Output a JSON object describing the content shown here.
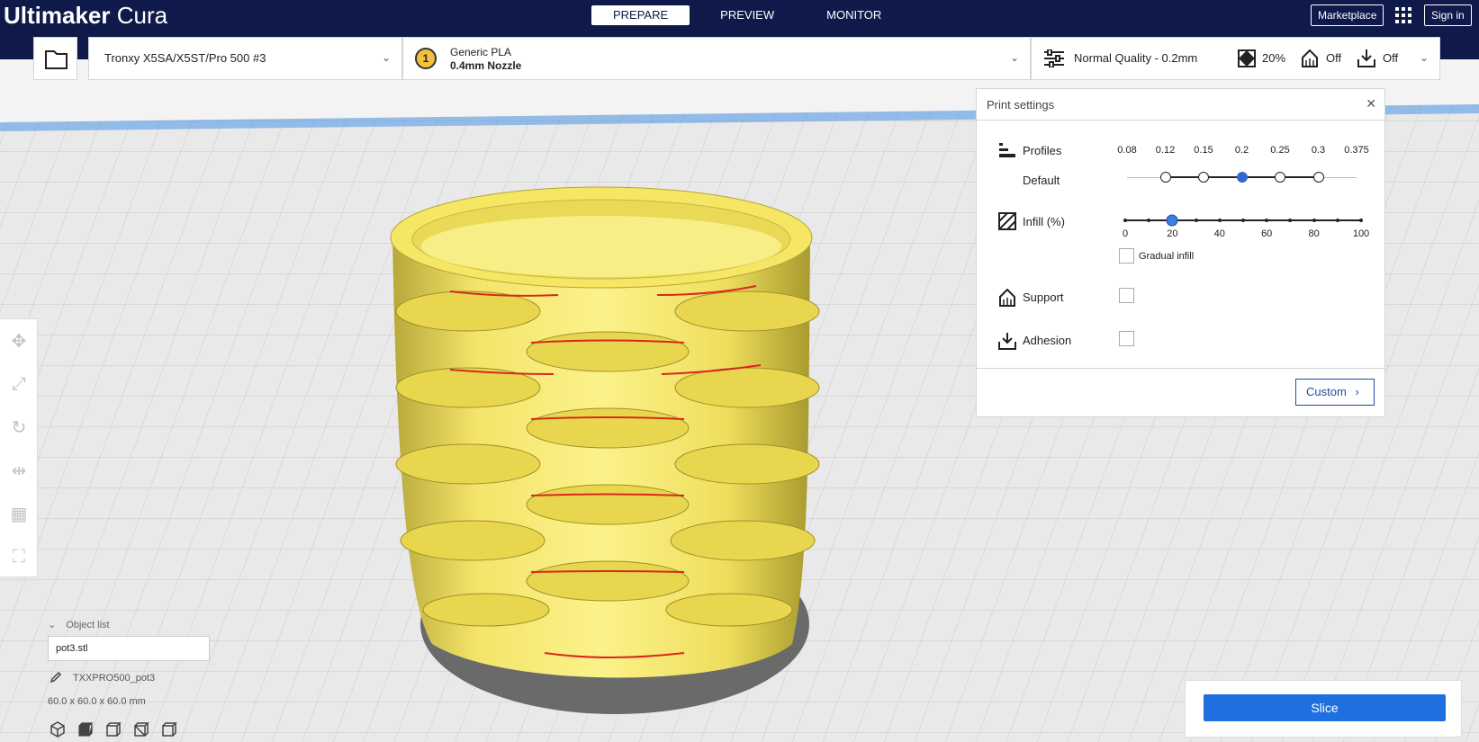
{
  "app": {
    "title_bold": "Ultimaker",
    "title_light": "Cura"
  },
  "stages": [
    {
      "label": "PREPARE",
      "active": true
    },
    {
      "label": "PREVIEW",
      "active": false
    },
    {
      "label": "MONITOR",
      "active": false
    }
  ],
  "header": {
    "marketplace": "Marketplace",
    "signin": "Sign in"
  },
  "printer": {
    "name": "Tronxy X5SA/X5ST/Pro 500 #3"
  },
  "material": {
    "extruder_number": "1",
    "name": "Generic PLA",
    "nozzle": "0.4mm Nozzle"
  },
  "settings_summary": {
    "quality": "Normal Quality - 0.2mm",
    "infill": "20%",
    "support": "Off",
    "adhesion": "Off"
  },
  "print_settings": {
    "title": "Print settings",
    "profiles_label": "Profiles",
    "profile_default": "Default",
    "profile_ticks": [
      "0.08",
      "0.12",
      "0.15",
      "0.2",
      "0.25",
      "0.3",
      "0.375"
    ],
    "profile_selected": "0.2",
    "infill_label": "Infill (%)",
    "infill_ticks": [
      "0",
      "20",
      "40",
      "60",
      "80",
      "100"
    ],
    "infill_value": 20,
    "gradual_infill": "Gradual infill",
    "support_label": "Support",
    "adhesion_label": "Adhesion",
    "custom_button": "Custom"
  },
  "object_list": {
    "header": "Object list",
    "file": "pot3.stl",
    "object_name": "TXXPRO500_pot3",
    "dimensions": "60.0 x 60.0 x 60.0 mm"
  },
  "slice": {
    "label": "Slice"
  },
  "colors": {
    "topbar": "#0f1a4a",
    "accent": "#1f6fe0",
    "model": "#f7ea5e"
  }
}
